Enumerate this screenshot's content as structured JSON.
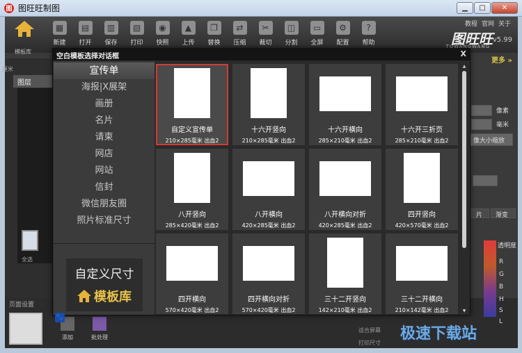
{
  "window": {
    "title": "图旺旺制图"
  },
  "toolbar": {
    "home_label": "模板库",
    "tools": [
      {
        "label": "新建",
        "icon": "new-file-icon",
        "glyph": "▦"
      },
      {
        "label": "打开",
        "icon": "open-folder-icon",
        "glyph": "▤"
      },
      {
        "label": "保存",
        "icon": "save-icon",
        "glyph": "▥"
      },
      {
        "label": "打印",
        "icon": "print-icon",
        "glyph": "▧"
      },
      {
        "label": "快照",
        "icon": "camera-icon",
        "glyph": "◉"
      },
      {
        "label": "上传",
        "icon": "upload-icon",
        "glyph": "▲"
      },
      {
        "label": "替换",
        "icon": "replace-icon",
        "glyph": "❐"
      },
      {
        "label": "压缩",
        "icon": "compress-icon",
        "glyph": "⇄"
      },
      {
        "label": "裁切",
        "icon": "scissors-icon",
        "glyph": "✂"
      },
      {
        "label": "分割",
        "icon": "split-icon",
        "glyph": "◫"
      },
      {
        "label": "全屏",
        "icon": "fullscreen-icon",
        "glyph": "▭"
      },
      {
        "label": "配置",
        "icon": "gear-icon",
        "glyph": "⚙"
      },
      {
        "label": "帮助",
        "icon": "help-icon",
        "glyph": "?"
      }
    ],
    "links": [
      "教程",
      "官网",
      "关于"
    ],
    "brand": "图旺旺",
    "brand_sub": "TUWANGWANG",
    "version": "v5.99",
    "more": "更多"
  },
  "left": {
    "layers_title": "图层",
    "layer_label": "全选",
    "ruler_label": "厘米"
  },
  "page_settings": {
    "title": "页面设置",
    "add": "添加",
    "batch": "批处理"
  },
  "right": {
    "unit_px": "像素",
    "unit_mm": "毫米",
    "scale": "像大小缩放",
    "tab1": "片",
    "tab2": "渐变",
    "opacity": "透明度",
    "channels": [
      "R",
      "G",
      "B",
      "H",
      "S",
      "L"
    ],
    "fit": "适合屏幕",
    "print_size": "打印尺寸"
  },
  "dialog": {
    "title": "空白模板选择对话框",
    "close": "X",
    "categories": [
      "宣传单",
      "海报|X展架",
      "画册",
      "名片",
      "请柬",
      "网店",
      "网站",
      "信封",
      "微信朋友圈",
      "照片标准尺寸"
    ],
    "active_category": 0,
    "custom_size": "自定义尺寸",
    "template_library": "模板库",
    "templates": [
      {
        "name": "自定义宣传单",
        "spec": "210×285毫米 出血2",
        "orientation": "portrait",
        "selected": true
      },
      {
        "name": "十六开竖向",
        "spec": "210×285毫米 出血2",
        "orientation": "portrait",
        "selected": false
      },
      {
        "name": "十六开横向",
        "spec": "285×210毫米 出血2",
        "orientation": "landscape",
        "selected": false
      },
      {
        "name": "十六开三折页",
        "spec": "285×210毫米 出血2",
        "orientation": "landscape",
        "selected": false
      },
      {
        "name": "八开竖向",
        "spec": "285×420毫米 出血2",
        "orientation": "portrait",
        "selected": false
      },
      {
        "name": "八开横向",
        "spec": "420×285毫米 出血2",
        "orientation": "landscape",
        "selected": false
      },
      {
        "name": "八开横向对折",
        "spec": "420×285毫米 出血2",
        "orientation": "landscape",
        "selected": false
      },
      {
        "name": "四开竖向",
        "spec": "420×570毫米 出血2",
        "orientation": "portrait",
        "selected": false
      },
      {
        "name": "四开横向",
        "spec": "570×420毫米 出血2",
        "orientation": "landscape",
        "selected": false
      },
      {
        "name": "四开横向对折",
        "spec": "570×420毫米 出血2",
        "orientation": "landscape",
        "selected": false
      },
      {
        "name": "三十二开竖向",
        "spec": "142×210毫米 出血2",
        "orientation": "portrait",
        "selected": false
      },
      {
        "name": "三十二开横向",
        "spec": "210×142毫米 出血2",
        "orientation": "landscape",
        "selected": false
      }
    ]
  },
  "watermark": "极速下载站"
}
